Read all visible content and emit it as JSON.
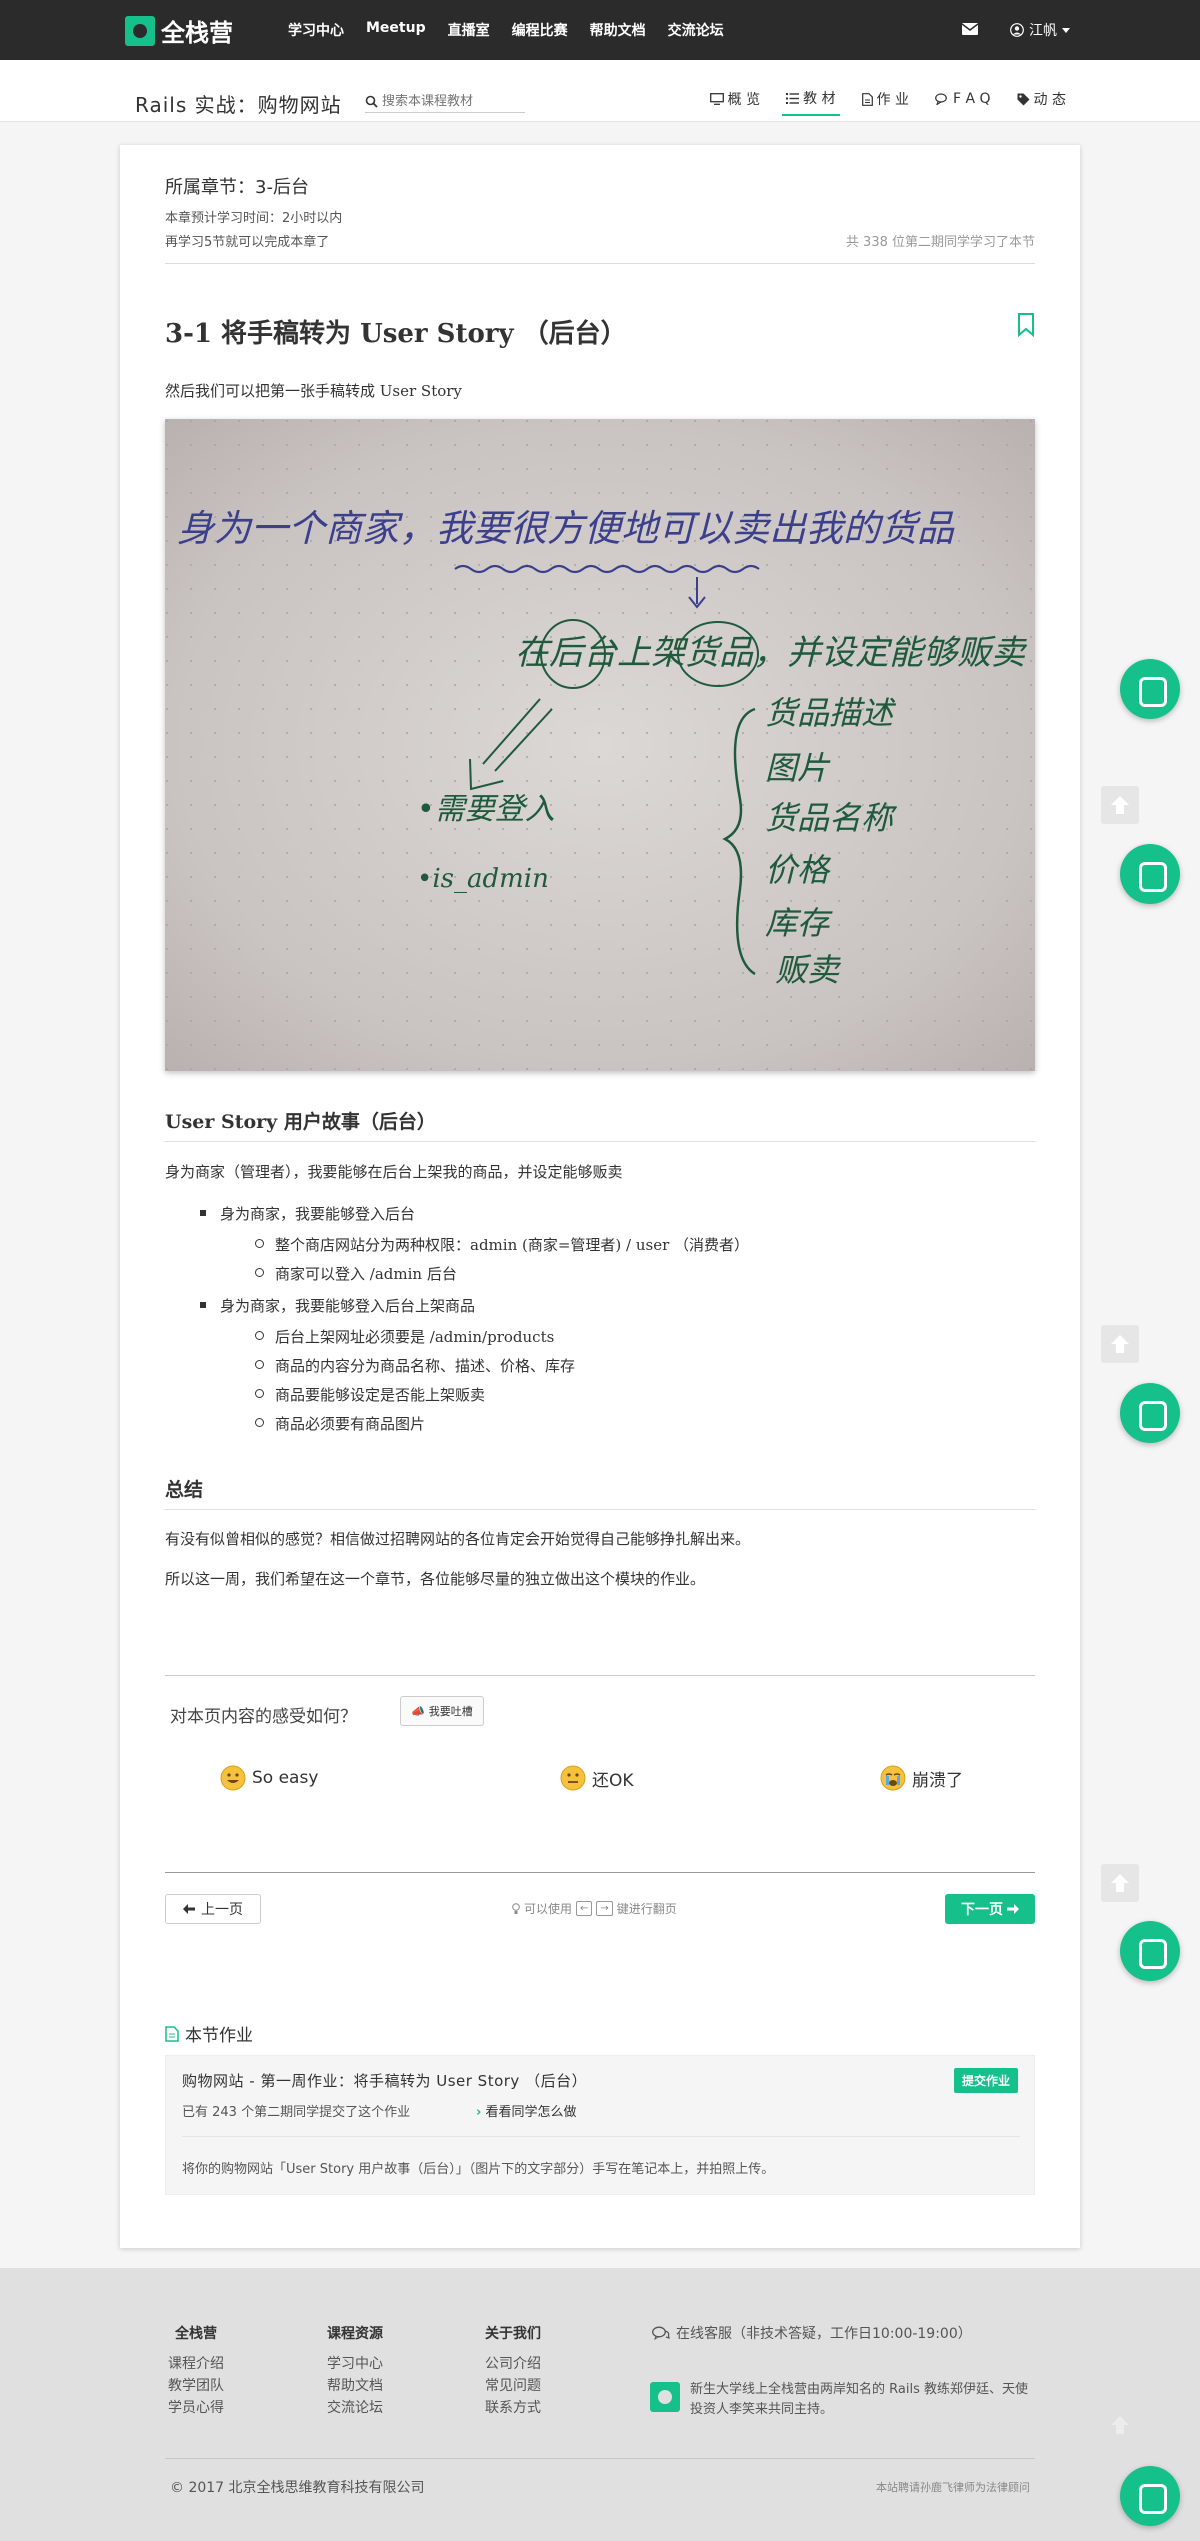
{
  "topnav": {
    "brand": "全栈营",
    "items": [
      "学习中心",
      "Meetup",
      "直播室",
      "编程比赛",
      "帮助文档",
      "交流论坛"
    ],
    "user_name": "江帆"
  },
  "subnav": {
    "course_title": "Rails 实战：购物网站",
    "search_placeholder": "搜索本课程教材",
    "tabs": [
      {
        "label": "概 览",
        "icon": "monitor-icon"
      },
      {
        "label": "教 材",
        "icon": "list-icon"
      },
      {
        "label": "作 业",
        "icon": "file-icon"
      },
      {
        "label": "F A Q",
        "icon": "chat-icon"
      },
      {
        "label": "动 态",
        "icon": "tag-icon"
      }
    ],
    "active_tab": 1
  },
  "lesson": {
    "chapter": "所属章节：3-后台",
    "time_estimate": "本章预计学习时间：2小时以内",
    "remaining": "再学习5节就可以完成本章了",
    "learners": "共 338 位第二期同学学习了本节",
    "title": "3-1 将手稿转为 User Story （后台）",
    "intro": "然后我们可以把第一张手稿转成 User Story",
    "photo": {
      "headline": "身为一个商家，我要很方便地可以卖出我的货品",
      "middle": "在后台上架货品，并设定能够贩卖",
      "left_items": [
        "•需要登入",
        "•is_admin"
      ],
      "right_items": [
        "货品描述",
        "图片",
        "货品名称",
        "价格",
        "库存",
        "贩卖"
      ]
    },
    "section1_title": "User Story 用户故事（后台）",
    "section1_para": "身为商家（管理者），我要能够在后台上架我的商品，并设定能够贩卖",
    "bullets": [
      {
        "text": "身为商家，我要能够登入后台",
        "sub": [
          "整个商店网站分为两种权限：admin (商家=管理者) / user （消费者）",
          "商家可以登入 /admin 后台"
        ]
      },
      {
        "text": "身为商家，我要能够登入后台上架商品",
        "sub": [
          "后台上架网址必须要是 /admin/products",
          "商品的内容分为商品名称、描述、价格、库存",
          "商品要能够设定是否能上架贩卖",
          "商品必须要有商品图片"
        ]
      }
    ],
    "section2_title": "总结",
    "summary1": "有没有似曾相似的感觉？相信做过招聘网站的各位肯定会开始觉得自己能够挣扎解出来。",
    "summary2": "所以这一周，我们希望在这一个章节，各位能够尽量的独立做出这个模块的作业。"
  },
  "feedback": {
    "question": "对本页内容的感受如何？",
    "complain_label": "我要吐槽",
    "options": [
      "So easy",
      "还OK",
      "崩溃了"
    ]
  },
  "pager": {
    "prev_label": "上一页",
    "hint_prefix": "可以使用",
    "hint_suffix": "键进行翻页",
    "key_left": "←",
    "key_right": "→",
    "next_label": "下一页"
  },
  "homework": {
    "section_title": "本节作业",
    "name": "购物网站 - 第一周作业：将手稿转为 User Story （后台）",
    "submit_label": "提交作业",
    "count_text": "已有 243 个第二期同学提交了这个作业",
    "peek_label": "看看同学怎么做",
    "description": "将你的购物网站「User Story 用户故事（后台）」（图片下的文字部分）手写在笔记本上，并拍照上传。"
  },
  "footer": {
    "columns": [
      {
        "title": "全栈营",
        "links": [
          "课程介绍",
          "教学团队",
          "学员心得"
        ]
      },
      {
        "title": "课程资源",
        "links": [
          "学习中心",
          "帮助文档",
          "交流论坛"
        ]
      },
      {
        "title": "关于我们",
        "links": [
          "公司介绍",
          "常见问题",
          "联系方式"
        ]
      }
    ],
    "service": "在线客服（非技术答疑，工作日10:00-19:00）",
    "intro": "新生大学线上全栈营由两岸知名的 Rails 教练郑伊廷、天使投资人李笑来共同主持。",
    "copyright": "© 2017 北京全栈思维教育科技有限公司",
    "legal": "本站聘请孙鹿飞律师为法律顾问"
  },
  "colors": {
    "accent": "#16c08a",
    "nav_bg": "#2b2b2b",
    "ink_blue": "#3b3f8c",
    "ink_green": "#1f5a3c"
  }
}
